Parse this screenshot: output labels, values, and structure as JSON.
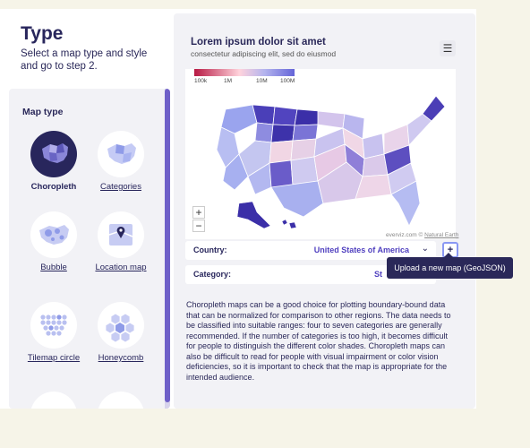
{
  "header": {
    "title": "Type",
    "subtitle": "Select a map type and style and go to step 2."
  },
  "map_type_panel": {
    "heading": "Map type",
    "tiles": [
      {
        "label": "Choropleth",
        "icon": "choropleth-icon",
        "selected": true
      },
      {
        "label": "Categories",
        "icon": "categories-icon",
        "selected": false
      },
      {
        "label": "Bubble",
        "icon": "bubble-icon",
        "selected": false
      },
      {
        "label": "Location map",
        "icon": "location-map-icon",
        "selected": false
      },
      {
        "label": "Tilemap circle",
        "icon": "tilemap-circle-icon",
        "selected": false
      },
      {
        "label": "Honeycomb",
        "icon": "honeycomb-icon",
        "selected": false
      }
    ]
  },
  "preview": {
    "title": "Lorem ipsum dolor sit amet",
    "subtitle": "consectetur adipiscing elit, sed do eiusmod",
    "menu_icon": "hamburger-menu-icon",
    "legend_ticks": [
      "100k",
      "1M",
      "10M",
      "100M"
    ],
    "credit_prefix": "everviz.com ©",
    "credit_link": "Natural Earth",
    "zoom_in": "+",
    "zoom_out": "−"
  },
  "fields": {
    "country_label": "Country:",
    "country_value": "United States of America",
    "category_label": "Category:",
    "category_value": "St",
    "add_map_button": "+"
  },
  "tooltip": "Upload a new map (GeoJSON)",
  "description": "Choropleth maps can be a good choice for plotting boundary-bound data that can be normalized for comparison to other regions. The data needs to be classified into suitable ranges: four to seven categories are generally recommended. If the number of categories is too high, it becomes difficult for people to distinguish the different color shades. Choropleth maps can also be difficult to read for people with visual impairment or color vision deficiencies, so it is important to check that the map is appropriate for the intended audience.",
  "colors": {
    "brand_dark": "#28265c",
    "accent": "#6f60c8",
    "background": "#f6f4e8",
    "panel": "#f2f2f6"
  }
}
